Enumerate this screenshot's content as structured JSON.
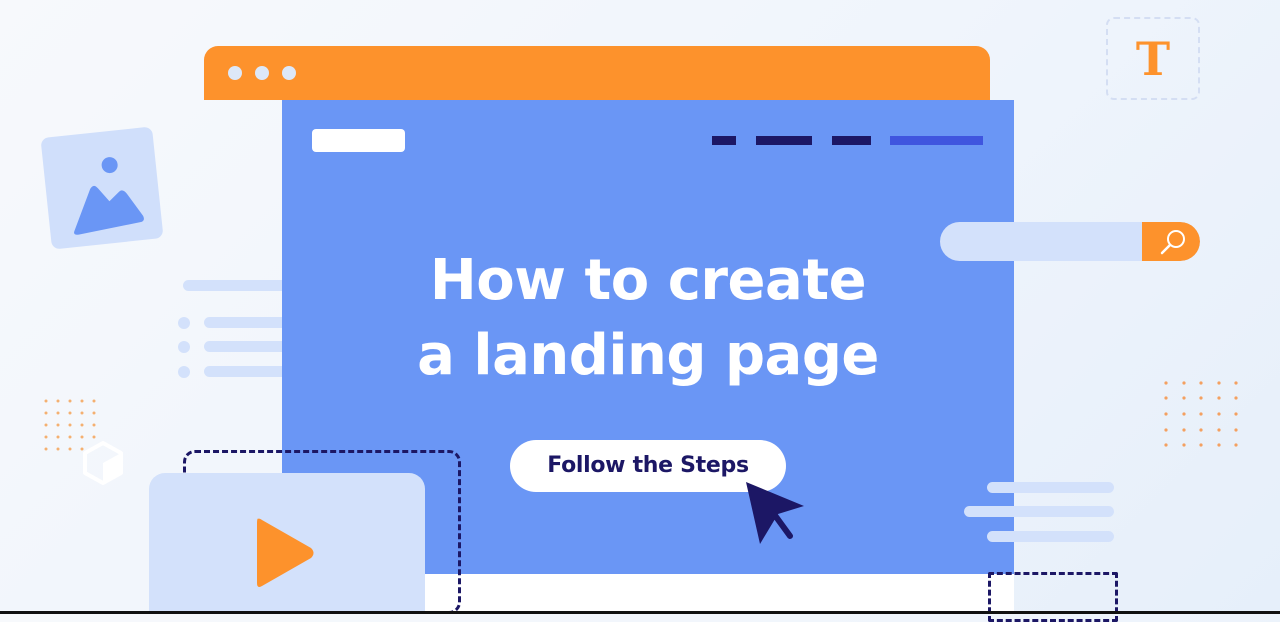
{
  "colors": {
    "accent_orange": "#fd922c",
    "panel_blue": "#6a96f5",
    "light_blue": "#d3e1fb",
    "navy": "#1c1765",
    "nav_active": "#3f55df",
    "white": "#ffffff"
  },
  "browser": {
    "window_dots": [
      "dot",
      "dot",
      "dot"
    ],
    "nav_items": [
      {
        "state": "inactive"
      },
      {
        "state": "inactive"
      },
      {
        "state": "inactive"
      },
      {
        "state": "active"
      }
    ]
  },
  "hero": {
    "headline_line1": "How to create",
    "headline_line2": "a landing page",
    "cta_label": "Follow the Steps"
  },
  "decor": {
    "text_tool_glyph": "T",
    "icons": {
      "search": "search-icon",
      "image": "image-icon",
      "play": "play-icon",
      "cursor": "cursor-pointer-icon",
      "cube": "cube-icon",
      "text": "text-tool-icon"
    }
  }
}
